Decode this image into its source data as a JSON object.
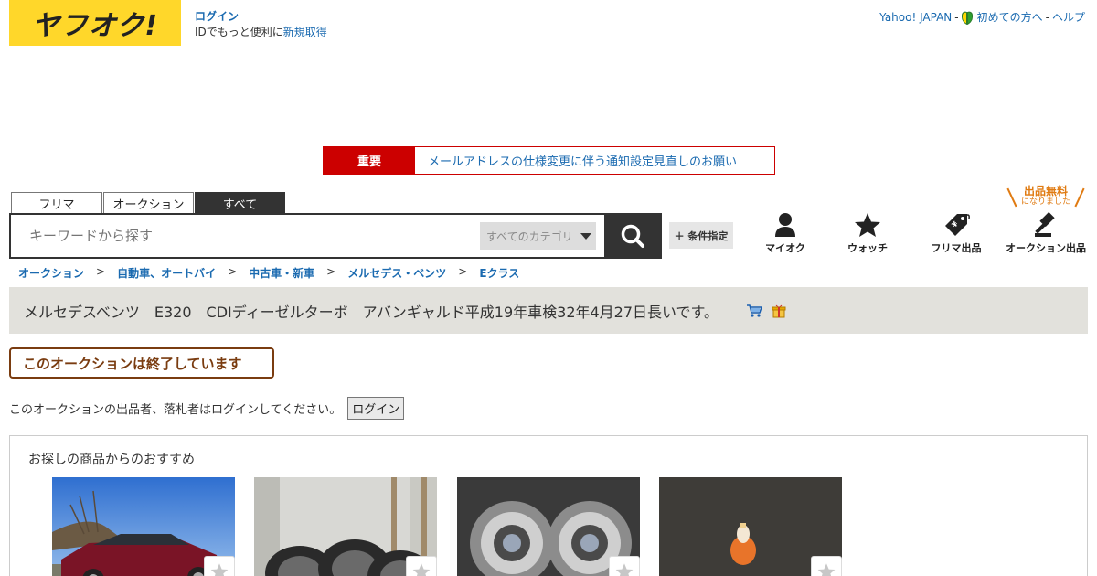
{
  "header": {
    "logo_text": "ヤフオク!",
    "login_label": "ログイン",
    "signup_prefix": "IDでもっと便利に",
    "signup_link": "新規取得",
    "top_links": {
      "yahoo_japan": "Yahoo! JAPAN",
      "beginner": "初めての方へ",
      "help": "ヘルプ"
    }
  },
  "notice": {
    "tag": "重要",
    "message": "メールアドレスの仕様変更に伴う通知設定見直しのお願い"
  },
  "search": {
    "tabs": [
      "フリマ",
      "オークション",
      "すべて"
    ],
    "active_tab": "すべて",
    "placeholder": "キーワードから探す",
    "category": "すべてのカテゴリ",
    "condition_button": "＋ 条件指定"
  },
  "shortcuts": {
    "badge_main": "出品無料",
    "badge_sub": "になりました",
    "items": [
      "マイオク",
      "ウォッチ",
      "フリマ出品",
      "オークション出品"
    ]
  },
  "breadcrumb": [
    "オークション",
    "自動車、オートバイ",
    "中古車・新車",
    "メルセデス・ベンツ",
    "Eクラス"
  ],
  "item": {
    "title": "メルセデスベンツ　E320　CDIディーゼルターボ　アバンギャルド平成19年車検32年4月27日長いです。"
  },
  "status": {
    "ended_label": "このオークションは終了しています",
    "login_note": "このオークションの出品者、落札者はログインしてください。",
    "login_button": "ログイン"
  },
  "recommendations": {
    "title": "お探しの商品からのおすすめ",
    "items": [
      {
        "kind": "red-car"
      },
      {
        "kind": "wheels"
      },
      {
        "kind": "headlights"
      },
      {
        "kind": "bulb"
      }
    ]
  },
  "colors": {
    "brand_yellow": "#ffd72a",
    "link_blue": "#1a6ab0",
    "notice_red": "#cc0000",
    "ended_brown": "#7a3c10",
    "badge_orange": "#e07b12"
  }
}
